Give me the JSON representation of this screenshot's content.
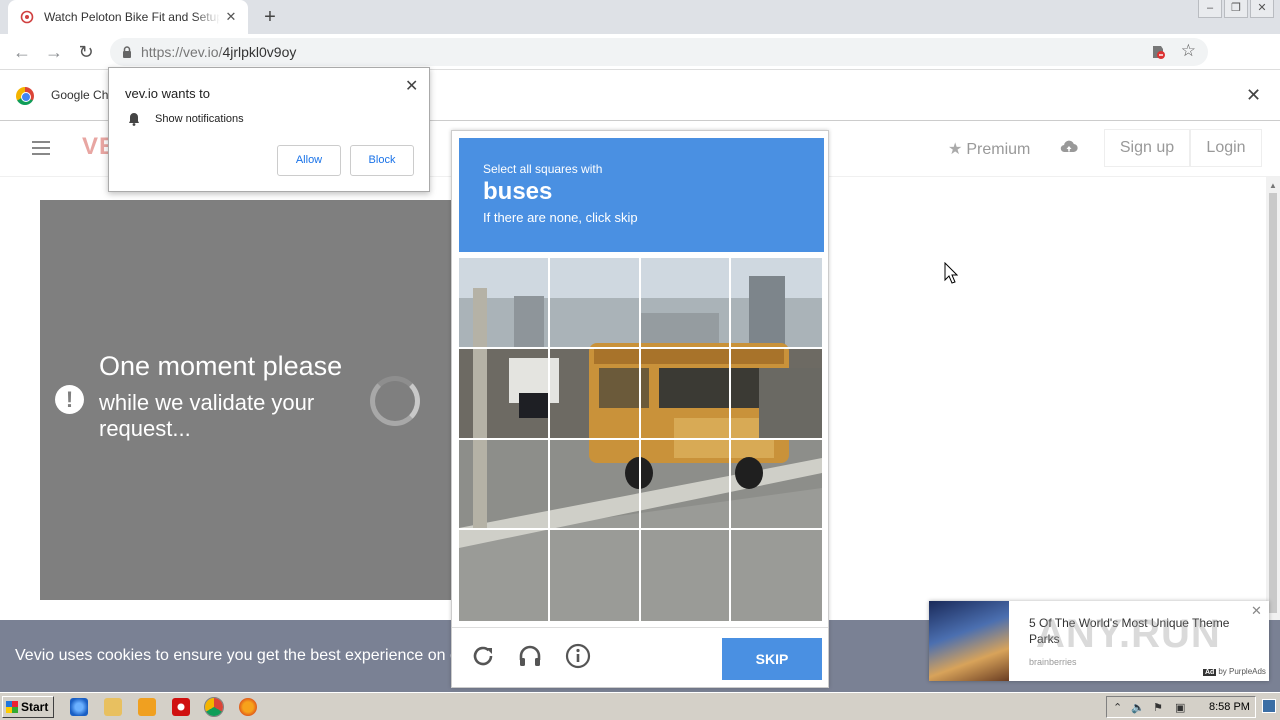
{
  "browser": {
    "tab_title": "Watch Peloton Bike Fit and Setup wi",
    "new_tab": "+",
    "url_host": "https://vev.io/",
    "url_path": "4jrlpkl0v9oy",
    "window_buttons": [
      "minimize",
      "restore",
      "close"
    ]
  },
  "infobar": {
    "text": "Google Ch",
    "close": "✕"
  },
  "permission_popup": {
    "title": "vev.io wants to",
    "item": "Show notifications",
    "allow": "Allow",
    "block": "Block",
    "close": "✕"
  },
  "site": {
    "logo": "VE",
    "premium": "Premium",
    "signup": "Sign up",
    "login": "Login"
  },
  "loading_box": {
    "title": "One moment please",
    "subtitle": "while we validate your request..."
  },
  "captcha": {
    "instruction": "Select all squares with",
    "target": "buses",
    "hint": "If there are none, click skip",
    "skip": "SKIP",
    "grid": "4x4",
    "icons": [
      "reload-icon",
      "audio-icon",
      "info-icon"
    ]
  },
  "cookie_bar": {
    "text": "Vevio uses cookies to ensure you get the best experience on o"
  },
  "ad": {
    "title": "5 Of The World's Most Unique Theme Parks",
    "source": "brainberries",
    "by_badge": "Ad",
    "by_text": "by PurpleAds",
    "watermark": "ANY.RUN"
  },
  "taskbar": {
    "start": "Start",
    "clock": "8:58 PM"
  },
  "colors": {
    "captcha_blue": "#4a90e2",
    "cookie_bar": "#7a8194",
    "loading_grey": "#7f7f7f"
  }
}
